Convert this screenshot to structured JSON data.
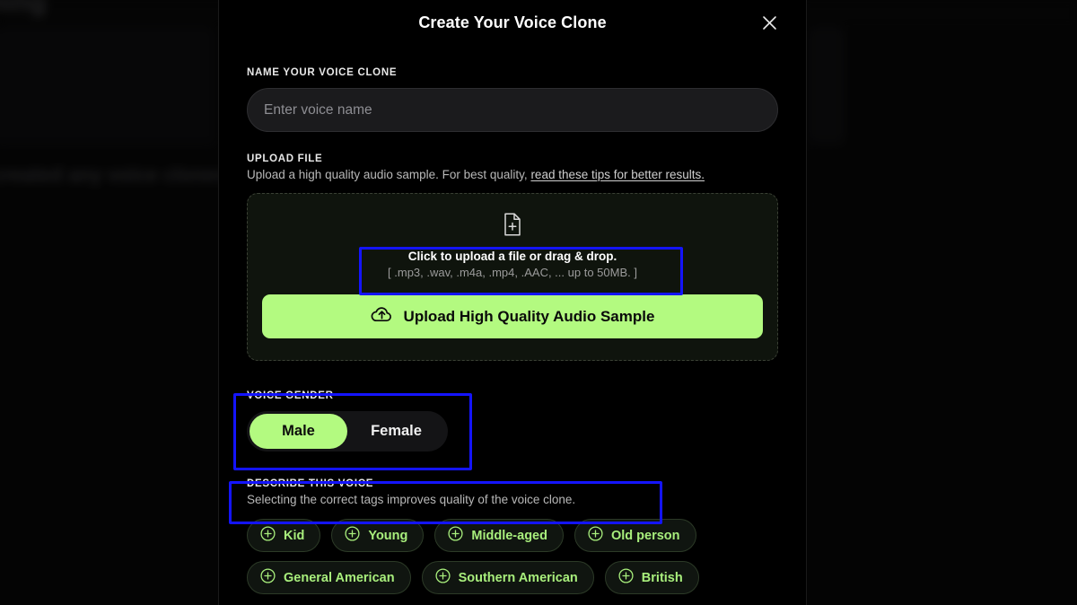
{
  "background": {
    "page_title": "...ning",
    "empty_state": "t created any voice clones yet"
  },
  "modal": {
    "title": "Create Your Voice Clone",
    "close_icon": "close-icon",
    "name_section": {
      "label": "NAME YOUR VOICE CLONE",
      "input_value": "",
      "placeholder": "Enter voice name"
    },
    "upload_section": {
      "label": "UPLOAD FILE",
      "description_prefix": "Upload a high quality audio sample. For best quality, ",
      "link_text": "read these tips for better results.",
      "dropzone": {
        "icon": "file-plus-icon",
        "main_text": "Click to upload a file or drag & drop.",
        "sub_text": "[ .mp3, .wav, .m4a, .mp4, .AAC, ... up to 50MB. ]"
      },
      "upload_button": {
        "icon": "cloud-upload-icon",
        "label": "Upload High Quality Audio Sample"
      }
    },
    "gender_section": {
      "label": "VOICE GENDER",
      "options": [
        {
          "label": "Male",
          "selected": true
        },
        {
          "label": "Female",
          "selected": false
        }
      ]
    },
    "describe_section": {
      "label": "DESCRIBE THIS VOICE",
      "description": "Selecting the correct tags improves quality of the voice clone.",
      "tag_rows": [
        [
          {
            "label": "Kid",
            "icon": "plus-circle-icon"
          },
          {
            "label": "Young",
            "icon": "plus-circle-icon"
          },
          {
            "label": "Middle-aged",
            "icon": "plus-circle-icon"
          },
          {
            "label": "Old person",
            "icon": "plus-circle-icon"
          }
        ],
        [
          {
            "label": "General American",
            "icon": "plus-circle-icon"
          },
          {
            "label": "Southern American",
            "icon": "plus-circle-icon"
          },
          {
            "label": "British",
            "icon": "plus-circle-icon"
          }
        ]
      ]
    }
  },
  "colors": {
    "accent_green": "#b3fa80",
    "tag_green": "#a8ee7c",
    "highlight_blue": "#1414ff",
    "modal_bg": "#000000"
  },
  "annotations": [
    {
      "name": "dropzone-text-highlight"
    },
    {
      "name": "voice-gender-highlight"
    },
    {
      "name": "describe-voice-highlight"
    }
  ]
}
